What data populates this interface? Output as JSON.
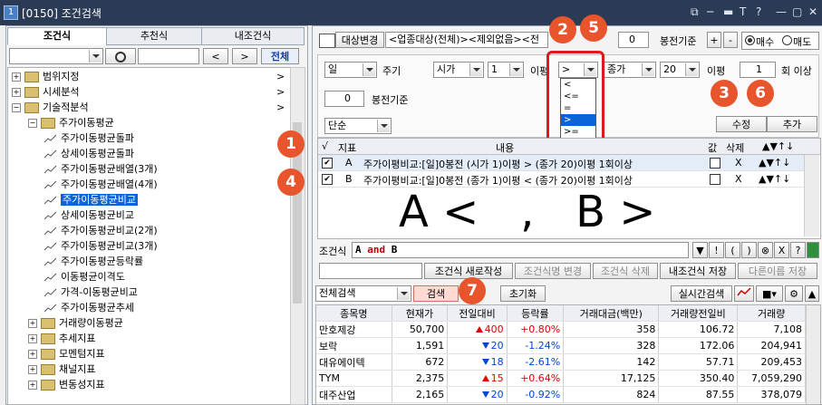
{
  "window": {
    "code": "[0150]",
    "title": "조건검색",
    "controls": [
      "⧉",
      "─",
      "▬",
      "T",
      "?",
      "—",
      "▢",
      "✕"
    ]
  },
  "left": {
    "tabs": [
      "조건식",
      "추천식",
      "내조건식"
    ],
    "search_buttons": [
      "<",
      ">",
      "전체"
    ],
    "tree": [
      {
        "label": "범위지정",
        "type": "folder",
        "level": 0,
        "arrow": ">"
      },
      {
        "label": "시세분석",
        "type": "folder",
        "level": 0,
        "arrow": ">"
      },
      {
        "label": "기술적분석",
        "type": "folder",
        "level": 0,
        "arrow": ">"
      },
      {
        "label": "주가이동평균",
        "type": "folder",
        "level": 1,
        "arrow": ""
      },
      {
        "label": "주가이동평균돌파",
        "type": "item",
        "level": 2
      },
      {
        "label": "상세이동평균돌파",
        "type": "item",
        "level": 2
      },
      {
        "label": "주가이동평균배열(3개)",
        "type": "item",
        "level": 2
      },
      {
        "label": "주가이동평균배열(4개)",
        "type": "item",
        "level": 2
      },
      {
        "label": "주가이동평균비교",
        "type": "item",
        "level": 2,
        "selected": true
      },
      {
        "label": "상세이동평균비교",
        "type": "item",
        "level": 2
      },
      {
        "label": "주가이동평균비교(2개)",
        "type": "item",
        "level": 2
      },
      {
        "label": "주가이동평균비교(3개)",
        "type": "item",
        "level": 2
      },
      {
        "label": "주가이동평균등락률",
        "type": "item",
        "level": 2
      },
      {
        "label": "이동평균이격도",
        "type": "item",
        "level": 2
      },
      {
        "label": "가격-이동평균비교",
        "type": "item",
        "level": 2
      },
      {
        "label": "주가이동평균추세",
        "type": "item",
        "level": 2
      },
      {
        "label": "거래량이동평균",
        "type": "folder",
        "level": 1,
        "arrow": ""
      },
      {
        "label": "추세지표",
        "type": "folder",
        "level": 1,
        "arrow": ""
      },
      {
        "label": "모멘텀지표",
        "type": "folder",
        "level": 1,
        "arrow": ""
      },
      {
        "label": "채널지표",
        "type": "folder",
        "level": 1,
        "arrow": ""
      },
      {
        "label": "변동성지표",
        "type": "folder",
        "level": 1,
        "arrow": ""
      }
    ]
  },
  "condition": {
    "target_button": "대상변경",
    "target_text": "<업종대상(전체)><제외없음><전",
    "bar_value": "0",
    "bar_label": "봉전기준",
    "plus": "+",
    "minus": "-",
    "radio_buy": "매수",
    "radio_sell": "매도",
    "period_select": "일",
    "period_label": "주기",
    "left_price": "시가",
    "left_n": "1",
    "avg_label": "이평",
    "operator": ">",
    "operator_options": [
      "<",
      "<=",
      "=",
      ">",
      ">="
    ],
    "operator_selected": 3,
    "right_price": "종가",
    "right_n": "20",
    "avg_label2": "이평",
    "times_value": "1",
    "times_label": "회 이상",
    "bar2_value": "0",
    "bar2_label": "봉전기준",
    "mode_select": "단순",
    "edit_button": "수정",
    "add_button": "추가"
  },
  "indicator_table": {
    "headers": [
      "√",
      "지표",
      "내용",
      "값",
      "삭제",
      "▲▼↑↓"
    ],
    "rows": [
      {
        "checked": true,
        "id": "A",
        "content": "주가이평비교:[일]0봉전 (시가 1)이평 > (종가 20)이평 1회이상",
        "del": "X",
        "move": "▲▼↑↓"
      },
      {
        "checked": true,
        "id": "B",
        "content": "주가이평비교:[일]0봉전 (종가 1)이평 < (종가 20)이평 1회이상",
        "del": "X",
        "move": "▲▼↑↓"
      }
    ]
  },
  "overlay_text": "A <   ,   B >",
  "formula": {
    "label": "조건식",
    "expr_a": "A",
    "expr_and": "and",
    "expr_b": "B",
    "ops": [
      "▼",
      "!",
      "(",
      ")",
      "⊗",
      "X",
      "?"
    ]
  },
  "actions": {
    "new": "조건식 새로작성",
    "rename": "조건식명 변경",
    "delete": "조건식 삭제",
    "save": "내조건식 저장",
    "save_as": "다른이름 저장"
  },
  "result": {
    "scope": "전체검색",
    "search_button": "검색",
    "reset_button": "초기화",
    "realtime_button": "실시간검색",
    "headers": [
      "종목명",
      "현재가",
      "전일대비",
      "등락률",
      "거래대금(백만)",
      "거래량전일비",
      "거래량"
    ],
    "rows": [
      {
        "name": "만호제강",
        "price": "50,700",
        "dir": "up",
        "diff": "400",
        "rate": "+0.80%",
        "amount": "358",
        "vol_ratio": "106.72",
        "volume": "7,108"
      },
      {
        "name": "보락",
        "price": "1,591",
        "dir": "down",
        "diff": "20",
        "rate": "-1.24%",
        "amount": "328",
        "vol_ratio": "172.06",
        "volume": "204,941"
      },
      {
        "name": "대유에이텍",
        "price": "672",
        "dir": "down",
        "diff": "18",
        "rate": "-2.61%",
        "amount": "142",
        "vol_ratio": "57.71",
        "volume": "209,453"
      },
      {
        "name": "TYM",
        "price": "2,375",
        "dir": "up",
        "diff": "15",
        "rate": "+0.64%",
        "amount": "17,125",
        "vol_ratio": "350.40",
        "volume": "7,059,290"
      },
      {
        "name": "대주산업",
        "price": "2,165",
        "dir": "down",
        "diff": "20",
        "rate": "-0.92%",
        "amount": "824",
        "vol_ratio": "87.55",
        "volume": "378,079"
      }
    ]
  },
  "badges": [
    "1",
    "2",
    "3",
    "4",
    "5",
    "6",
    "7"
  ],
  "colors": {
    "badge": "#e8552c",
    "highlight_box": "#e01818",
    "selection": "#0a64d8",
    "up": "#e00000",
    "down": "#0046d5"
  }
}
